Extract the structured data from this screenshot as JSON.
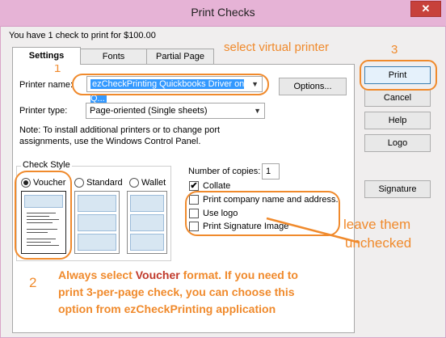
{
  "window": {
    "title": "Print Checks",
    "close_glyph": "✕"
  },
  "summary": "You have 1 check to print for $100.00",
  "tabs": [
    {
      "label": "Settings"
    },
    {
      "label": "Fonts"
    },
    {
      "label": "Partial Page"
    }
  ],
  "printer_name": {
    "label": "Printer name:",
    "value": "ezCheckPrinting Quickbooks Driver on Q..."
  },
  "options_button": "Options...",
  "printer_type": {
    "label": "Printer type:",
    "value": "Page-oriented (Single sheets)"
  },
  "note": [
    "Note: To install additional printers or to change port",
    "assignments, use the Windows Control Panel."
  ],
  "check_style": {
    "legend": "Check Style",
    "options": [
      {
        "label": "Voucher",
        "selected": true
      },
      {
        "label": "Standard",
        "selected": false
      },
      {
        "label": "Wallet",
        "selected": false
      }
    ]
  },
  "copies": {
    "label": "Number of copies:",
    "value": "1"
  },
  "checkboxes": [
    {
      "label": "Collate",
      "checked": true
    },
    {
      "label": "Print company name and address.",
      "checked": false
    },
    {
      "label": "Use logo",
      "checked": false
    },
    {
      "label": "Print Signature Image",
      "checked": false
    }
  ],
  "side_buttons": {
    "print": "Print",
    "cancel": "Cancel",
    "help": "Help",
    "logo": "Logo",
    "signature": "Signature"
  },
  "annotations": {
    "step1": "1",
    "step2": "2",
    "step3": "3",
    "select_virtual_printer": "select virtual printer",
    "leave_unchecked_1": "leave them",
    "leave_unchecked_2": "unchecked",
    "voucher_note_prefix": "Always select ",
    "voucher_note_bold": "Voucher",
    "voucher_note_suffix": " format. If you need to",
    "voucher_note_line2": "print 3-per-page check, you can choose this",
    "voucher_note_line3": "option from ezCheckPrinting application"
  },
  "colors": {
    "annotation": "#f08a2c",
    "titlebar": "#e6b3d6",
    "close": "#c7413b",
    "selection": "#3399ff",
    "voucher_red": "#c0392b"
  }
}
